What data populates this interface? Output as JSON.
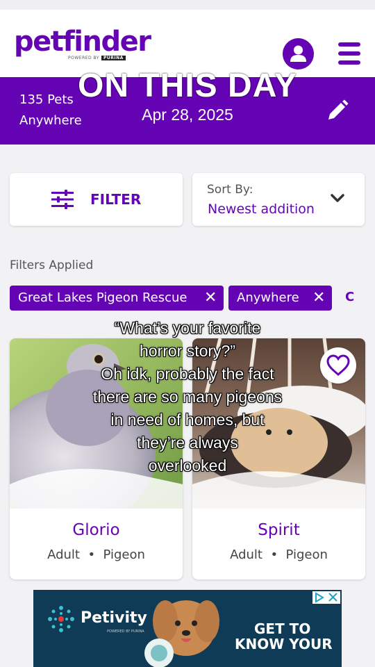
{
  "header": {
    "logo_text": "petfinder",
    "logo_powered": "POWERED BY",
    "logo_purina": "PURINA"
  },
  "banner": {
    "pet_count": "135 Pets",
    "location": "Anywhere",
    "overlay_title": "ON THIS DAY",
    "overlay_date": "Apr 28, 2025"
  },
  "controls": {
    "filter_label": "FILTER",
    "sort_label": "Sort By:",
    "sort_value": "Newest addition"
  },
  "filters": {
    "label": "Filters Applied",
    "chips": [
      "Great Lakes Pigeon Rescue",
      "Anywhere"
    ],
    "more": "C"
  },
  "pets": [
    {
      "name": "Glorio",
      "age": "Adult",
      "separator": "•",
      "species": "Pigeon"
    },
    {
      "name": "Spirit",
      "age": "Adult",
      "separator": "•",
      "species": "Pigeon"
    }
  ],
  "caption": {
    "lines": [
      "“What’s your favorite",
      "horror story?”",
      "Oh idk, probably the fact",
      "there are so many pigeons",
      "in need of homes, but",
      "they’re always",
      "overlooked"
    ]
  },
  "ad": {
    "brand": "Petivity",
    "brand_sub": "POWERED BY PURINA",
    "cta_line1": "GET TO",
    "cta_line2": "KNOW YOUR"
  },
  "colors": {
    "brand_purple": "#6504b5",
    "background": "#f2f1f4",
    "ad_background": "#0f3b56"
  },
  "icons": [
    "account-icon",
    "hamburger-menu-icon",
    "pencil-icon",
    "sliders-icon",
    "chevron-down-icon",
    "close-icon",
    "heart-icon",
    "adchoices-icon"
  ]
}
